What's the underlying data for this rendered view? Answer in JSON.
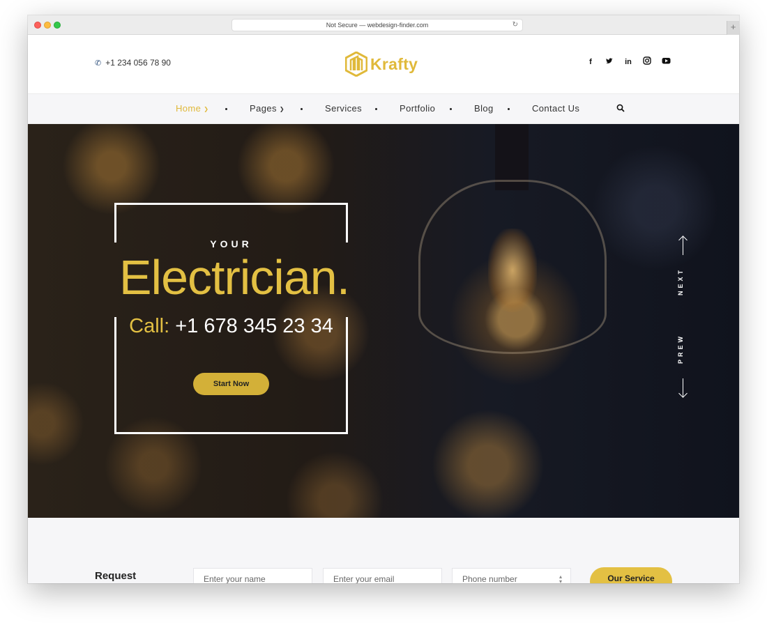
{
  "browser": {
    "url_text": "Not Secure — webdesign-finder.com",
    "reload_icon": "reload-icon",
    "new_tab_icon": "+"
  },
  "header": {
    "phone": "+1 234 056 78 90",
    "logo_text": "Krafty",
    "socials": [
      "f",
      "t",
      "in",
      "ig",
      "yt"
    ]
  },
  "nav": {
    "items": [
      {
        "label": "Home",
        "has_dropdown": true,
        "active": true
      },
      {
        "label": "Pages",
        "has_dropdown": true,
        "active": false
      },
      {
        "label": "Services",
        "has_dropdown": false,
        "active": false
      },
      {
        "label": "Portfolio",
        "has_dropdown": false,
        "active": false
      },
      {
        "label": "Blog",
        "has_dropdown": false,
        "active": false
      },
      {
        "label": "Contact Us",
        "has_dropdown": false,
        "active": false
      }
    ]
  },
  "hero": {
    "small": "YOUR",
    "title": "Electrician.",
    "call_label": "Call:",
    "call_number": "+1 678 345 23 34",
    "button": "Start Now",
    "next_label": "NEXT",
    "prev_label": "PREW"
  },
  "request": {
    "label": "Request",
    "name_placeholder": "Enter your name",
    "email_placeholder": "Enter your email",
    "phone_placeholder": "Phone number",
    "button": "Our Service"
  },
  "colors": {
    "accent": "#e3c043",
    "hero_bg": "#171a24",
    "nav_bg": "#f6f6f8"
  }
}
